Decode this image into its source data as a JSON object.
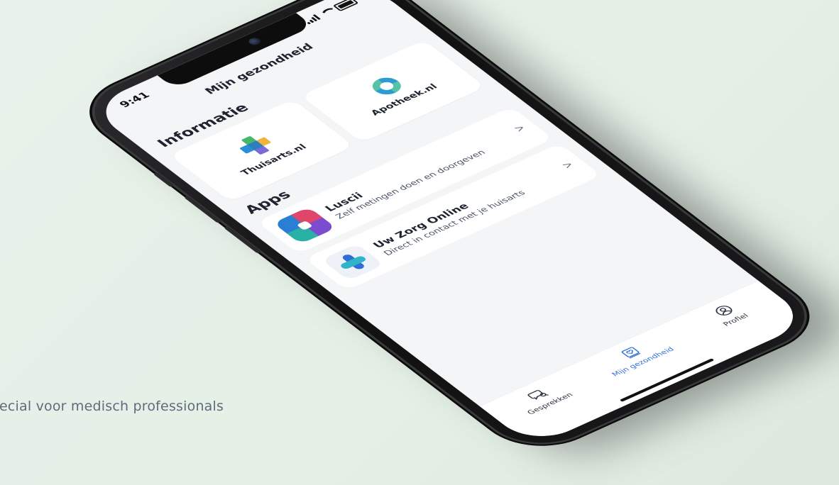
{
  "background": {
    "tagline": "ecial voor medisch professionals"
  },
  "status_bar": {
    "time": "9:41"
  },
  "screen": {
    "title": "Mijn gezondheid",
    "sections": {
      "informatie": {
        "title": "Informatie",
        "tiles": [
          {
            "label": "Thuisarts.nl",
            "icon": "thuisarts-logo"
          },
          {
            "label": "Apotheek.nl",
            "icon": "apotheek-logo"
          }
        ]
      },
      "apps": {
        "title": "Apps",
        "items": [
          {
            "name": "Luscii",
            "description": "Zelf metingen doen en doorgeven",
            "icon": "luscii-logo",
            "chevron": ">"
          },
          {
            "name": "Uw Zorg Online",
            "description": "Direct in contact met je huisarts",
            "icon": "uw-zorg-online-logo",
            "chevron": ">"
          }
        ]
      }
    },
    "tabbar": {
      "tabs": [
        {
          "label": "Gesprekken",
          "icon": "chat-search-icon",
          "active": false
        },
        {
          "label": "Mijn gezondheid",
          "icon": "heart-book-icon",
          "active": true
        },
        {
          "label": "Profiel",
          "icon": "profile-icon",
          "active": false
        }
      ]
    }
  },
  "colors": {
    "accent": "#2f6fd8",
    "screen_bg": "#f4f5f7",
    "card_bg": "#ffffff",
    "page_bg": "#e6f0e8"
  }
}
